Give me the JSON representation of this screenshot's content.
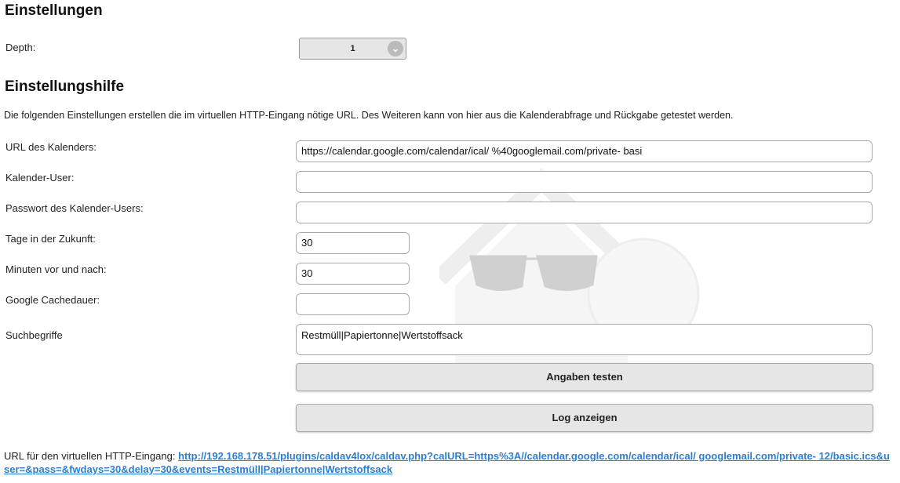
{
  "settings": {
    "title": "Einstellungen",
    "depth_label": "Depth:",
    "depth_value": "1"
  },
  "help": {
    "title": "Einstellungshilfe",
    "description": "Die folgenden Einstellungen erstellen die im virtuellen HTTP-Eingang nötige URL. Des Weiteren kann von hier aus die Kalenderabfrage und Rückgabe getestet werden."
  },
  "fields": [
    {
      "label": "URL des Kalenders:",
      "value": "https://calendar.google.com/calendar/ical/                        %40googlemail.com/private-                                          basi"
    },
    {
      "label": "Kalender-User:",
      "value": ""
    },
    {
      "label": "Passwort des Kalender-Users:",
      "value": ""
    },
    {
      "label": "Tage in der Zukunft:",
      "value": "30"
    },
    {
      "label": "Minuten vor und nach:",
      "value": "30"
    },
    {
      "label": "Google Cachedauer:",
      "value": ""
    },
    {
      "label": "Suchbegriffe",
      "value": "Restmüll|Papiertonne|Wertstoffsack"
    }
  ],
  "buttons": {
    "test": "Angaben testen",
    "log": "Log anzeigen"
  },
  "result": {
    "label": "URL für den virtuellen HTTP-Eingang:",
    "url": "http://192.168.178.51/plugins/caldav4lox/caldav.php?calURL=https%3A//calendar.google.com/calendar/ical/                googlemail.com/private-                                     12/basic.ics&user=&pass=&fwdays=30&delay=30&events=Restmüll|Papiertonne|Wertstoffsack"
  }
}
